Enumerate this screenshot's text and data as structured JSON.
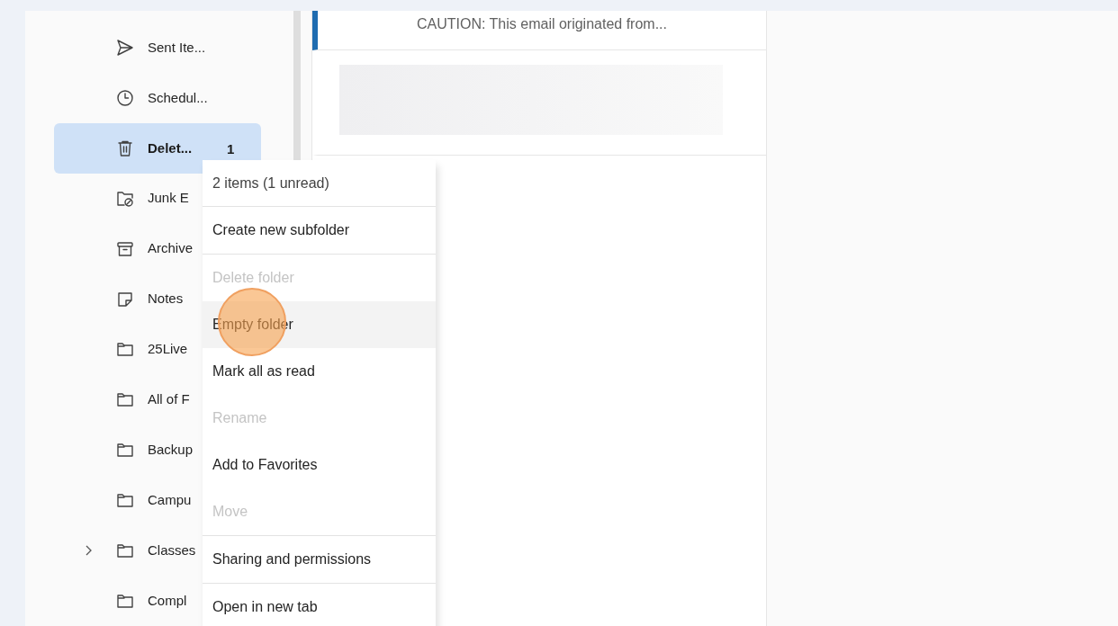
{
  "folders": [
    {
      "kind": "send",
      "label": "Sent Ite...",
      "selected": false,
      "expandable": false
    },
    {
      "kind": "clock",
      "label": "Schedul...",
      "selected": false,
      "expandable": false
    },
    {
      "kind": "trash",
      "label": "Delet...",
      "count": "1",
      "selected": true,
      "expandable": false
    },
    {
      "kind": "junk",
      "label": "Junk E",
      "selected": false,
      "expandable": false
    },
    {
      "kind": "archive",
      "label": "Archive",
      "selected": false,
      "expandable": false
    },
    {
      "kind": "note",
      "label": "Notes",
      "selected": false,
      "expandable": false
    },
    {
      "kind": "folder",
      "label": "25Live",
      "selected": false,
      "expandable": false
    },
    {
      "kind": "folder",
      "label": "All of F",
      "selected": false,
      "expandable": false
    },
    {
      "kind": "folder",
      "label": "Backup",
      "selected": false,
      "expandable": false
    },
    {
      "kind": "folder",
      "label": "Campu",
      "selected": false,
      "expandable": false
    },
    {
      "kind": "folder",
      "label": "Classes",
      "selected": false,
      "expandable": true
    },
    {
      "kind": "folder",
      "label": "Compl",
      "selected": false,
      "expandable": false
    }
  ],
  "messages": [
    {
      "preview": "CAUTION: This email originated from...",
      "selected": true
    },
    {
      "redacted": true,
      "selected": false
    }
  ],
  "context_menu": {
    "info": "2 items (1 unread)",
    "groups": [
      [
        {
          "label": "Create new subfolder",
          "disabled": false,
          "selected": false
        }
      ],
      [
        {
          "label": "Delete folder",
          "disabled": true,
          "selected": false
        },
        {
          "label": "Empty folder",
          "disabled": false,
          "selected": true
        },
        {
          "label": "Mark all as read",
          "disabled": false,
          "selected": false
        },
        {
          "label": "Rename",
          "disabled": true,
          "selected": false
        },
        {
          "label": "Add to Favorites",
          "disabled": false,
          "selected": false
        },
        {
          "label": "Move",
          "disabled": true,
          "selected": false
        }
      ],
      [
        {
          "label": "Sharing and permissions",
          "disabled": false,
          "selected": false
        }
      ],
      [
        {
          "label": "Open in new tab",
          "disabled": false,
          "selected": false
        }
      ]
    ]
  }
}
